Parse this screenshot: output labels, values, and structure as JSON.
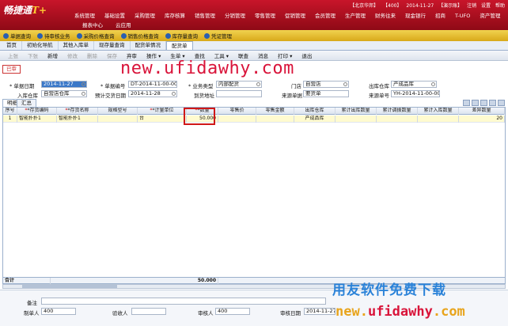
{
  "header": {
    "logo": "畅捷通",
    "logo_mark": "T+",
    "toplinks": [
      "【北京华邦】",
      "【400】",
      "2014-11-27",
      "【演示账】",
      "注销",
      "设置",
      "帮助"
    ],
    "menu": [
      "系统管理",
      "基础设置",
      "采购管理",
      "库存核算",
      "销售管理",
      "分销管理",
      "零售管理",
      "促销管理",
      "会员管理",
      "生产管理",
      "财务往来",
      "现金银行",
      "招商",
      "T-UFO",
      "资产管理"
    ],
    "submenu": [
      "报表中心",
      "云应用"
    ]
  },
  "quickbar": [
    "单据查询",
    "待审核业务",
    "采购价格查询",
    "销售价格查询",
    "库存量查询",
    "凭证管理"
  ],
  "tabs": [
    "首页",
    "初始化导航",
    "其他入库单",
    "现存量查询",
    "配货单情况",
    "配货单"
  ],
  "active_tab_index": 5,
  "toolbar": [
    {
      "label": "上张",
      "enabled": false
    },
    {
      "label": "下张",
      "enabled": false
    },
    {
      "label": "新增",
      "enabled": true
    },
    {
      "label": "修改",
      "enabled": false
    },
    {
      "label": "删除",
      "enabled": false
    },
    {
      "label": "保存",
      "enabled": false
    },
    {
      "label": "弃审",
      "enabled": true
    },
    {
      "label": "操作 ▾",
      "enabled": true
    },
    {
      "label": "生单 ▾",
      "enabled": true
    },
    {
      "label": "查找",
      "enabled": true
    },
    {
      "label": "工具 ▾",
      "enabled": true
    },
    {
      "label": "联查",
      "enabled": true
    },
    {
      "label": "消息",
      "enabled": true
    },
    {
      "label": "打印 ▾",
      "enabled": true
    },
    {
      "label": "退出",
      "enabled": true
    }
  ],
  "watermark": "new.ufidawhy.com",
  "status": "已审",
  "form": {
    "date_label": "* 单据日期",
    "date_value": "2014-11-27",
    "code_label": "* 单据编号",
    "code_value": "DT-2014-11-00-00...",
    "biztype_label": "* 业务类型",
    "biztype_value": "内部配货",
    "store_label": "门店",
    "store_value": "自营店",
    "out_wh_label": "出库仓库",
    "out_wh_value": "产成品库",
    "in_wh_label": "入库仓库",
    "in_wh_value": "自营店仓库",
    "plan_date_label": "预计交货日期",
    "plan_date_value": "2014-11-28",
    "arrive_label": "到货地址",
    "arrive_value": "",
    "src_type_label": "来源单据",
    "src_type_value": "要货单",
    "src_no_label": "来源单号",
    "src_no_value": "YH-2014-11-00-00..."
  },
  "detail_tabs": [
    "明细",
    "汇总"
  ],
  "grid": {
    "columns": [
      "序号",
      "*存货编码",
      "*存货名称",
      "规格型号",
      "*计量单位",
      "*数量",
      "零售价",
      "零售金额",
      "出库仓库",
      "累计出库数量",
      "累计调拨数量",
      "累计入库数量",
      "差异数量"
    ],
    "required": [
      false,
      true,
      true,
      false,
      true,
      true,
      false,
      false,
      false,
      false,
      false,
      false,
      false
    ],
    "rows": [
      [
        "1",
        "智能扑扑1",
        "智能扑扑1",
        "",
        "台",
        "50.000",
        "",
        "",
        "产成品库",
        "",
        "",
        "",
        "20"
      ]
    ],
    "total_label": "合计",
    "total_qty": "50.000"
  },
  "footer": {
    "note_label": "备注",
    "note_value": "",
    "maker_label": "制单人",
    "maker_value": "400",
    "checker_label": "验收人",
    "checker_value": "",
    "auditor_label": "审核人",
    "auditor_value": "400",
    "audit_date_label": "审核日期",
    "audit_date_value": "2014-11-27",
    "other_label": "确认人",
    "other_value": "400"
  },
  "promo": "用友软件免费下载",
  "promo_url_a": "new.",
  "promo_url_b": "ufidawhy",
  "promo_url_c": ".com"
}
